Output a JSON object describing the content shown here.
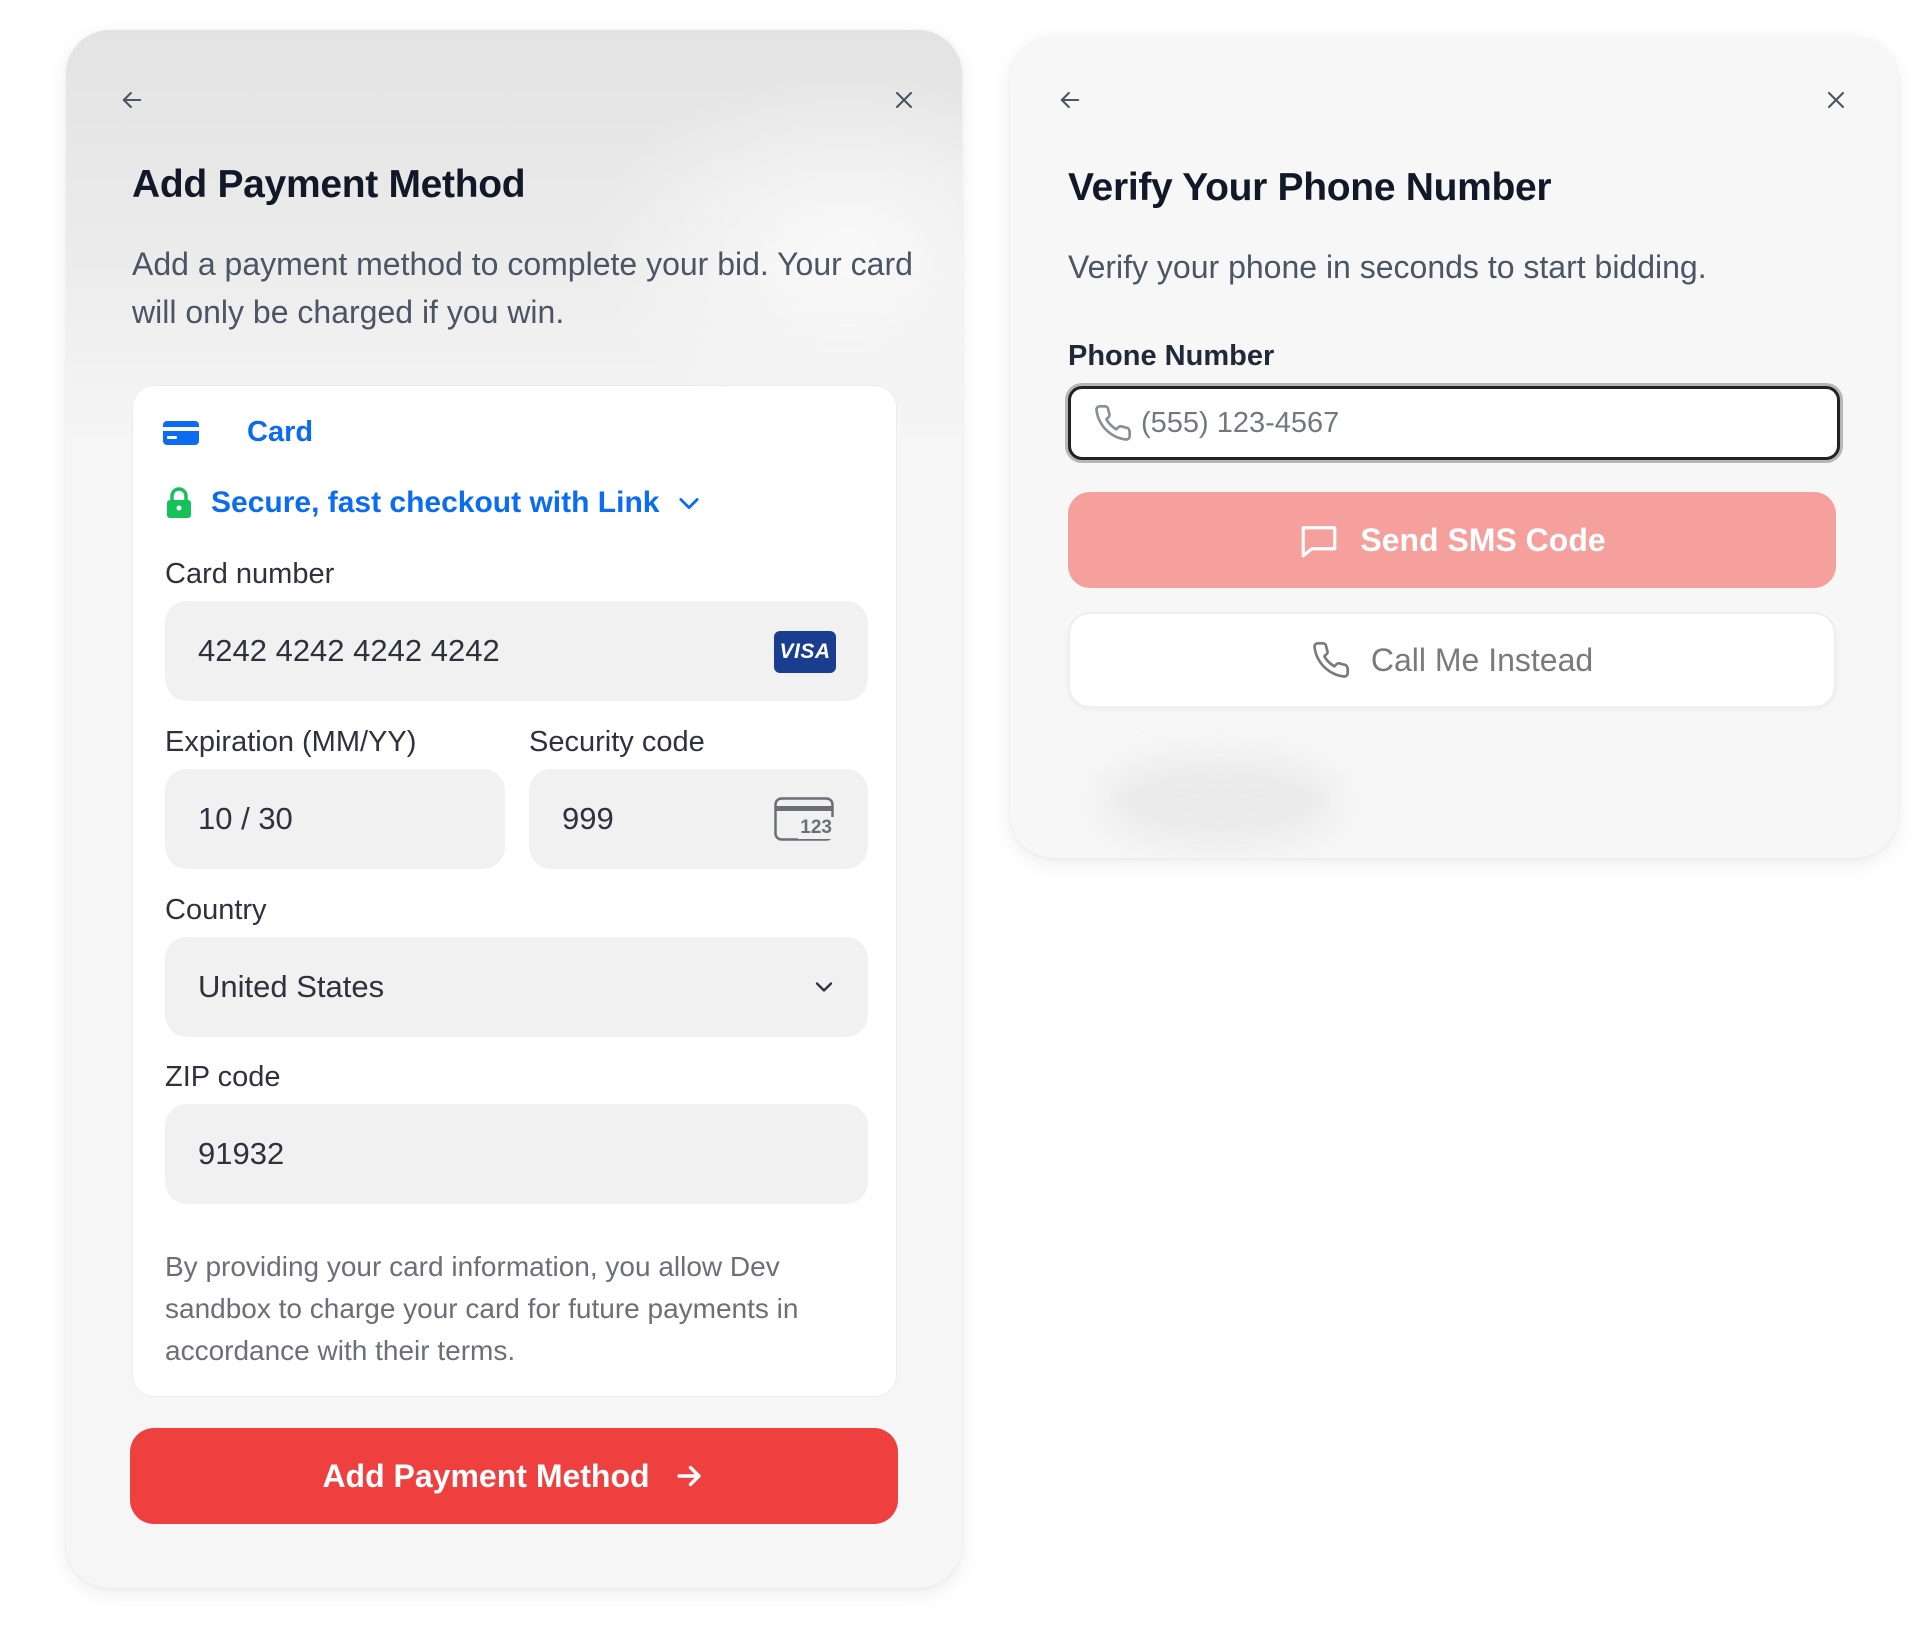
{
  "payment_modal": {
    "title": "Add Payment Method",
    "description": "Add a payment method to complete your bid. Your card will only be charged if you win.",
    "tab_card_label": "Card",
    "link_checkout_label": "Secure, fast checkout with Link",
    "card_number": {
      "label": "Card number",
      "value": "4242 4242 4242 4242",
      "brand": "VISA"
    },
    "expiration": {
      "label": "Expiration (MM/YY)",
      "value": "10 / 30"
    },
    "security_code": {
      "label": "Security code",
      "value": "999",
      "icon_text": "123"
    },
    "country": {
      "label": "Country",
      "value": "United States"
    },
    "zip": {
      "label": "ZIP code",
      "value": "91932"
    },
    "disclaimer": "By providing your card information, you allow Dev sandbox to charge your card for future payments in accordance with their terms.",
    "submit_label": "Add Payment Method"
  },
  "verify_modal": {
    "title": "Verify Your Phone Number",
    "description": "Verify your phone in seconds to start bidding.",
    "phone_label": "Phone Number",
    "phone_placeholder": "(555) 123-4567",
    "phone_value": "",
    "sms_button_label": "Send SMS Code",
    "call_button_label": "Call Me Instead"
  },
  "colors": {
    "primary_red": "#ef4040",
    "disabled_red": "#f5a09d",
    "link_blue": "#0a6cf0",
    "lock_green": "#16c15a",
    "visa_blue": "#1a3e8f"
  },
  "icons": {
    "back": "arrow-left-icon",
    "close": "close-icon",
    "card": "credit-card-icon",
    "lock": "lock-icon",
    "chevron": "chevron-down-icon",
    "cvc": "cvc-card-icon",
    "phone": "phone-icon",
    "message": "message-icon",
    "arrow_right": "arrow-right-icon"
  }
}
